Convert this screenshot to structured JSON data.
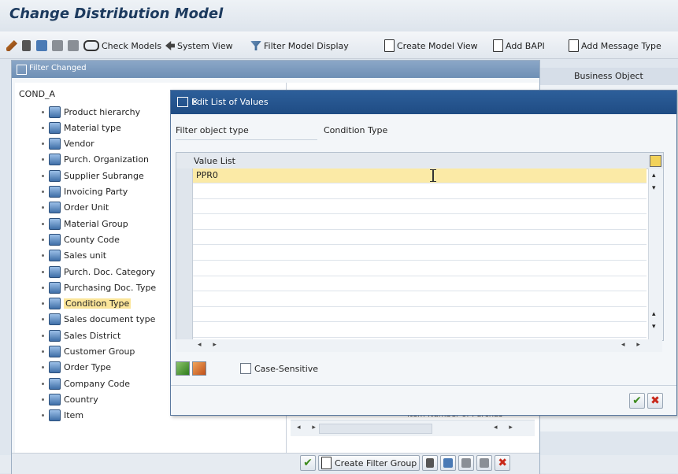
{
  "window": {
    "title": "Change Distribution Model"
  },
  "toolbar": {
    "check_models": "Check Models",
    "system_view": "System View",
    "filter_model_display": "Filter Model Display",
    "create_model_view": "Create Model View",
    "add_bapi": "Add BAPI",
    "add_message_type": "Add Message Type"
  },
  "background": {
    "business_object_header": "Business Object",
    "cut_text": "Item Number of Purchas"
  },
  "filter_dialog": {
    "title": "Filter Changed",
    "root": "COND_A",
    "items": [
      "Product hierarchy",
      "Material type",
      "Vendor",
      "Purch. Organization",
      "Supplier Subrange",
      "Invoicing Party",
      "Order Unit",
      "Material Group",
      "County Code",
      "Sales unit",
      "Purch. Doc. Category",
      "Purchasing Doc. Type",
      "Condition Type",
      "Sales document type",
      "Sales District",
      "Customer Group",
      "Order Type",
      "Company Code",
      "Country",
      "Item"
    ],
    "selected_item": "Condition Type",
    "create_filter_group": "Create Filter Group"
  },
  "edit_dialog": {
    "title": "Edit List of Values",
    "field_label": "Filter object type",
    "field_value": "Condition Type",
    "column_header": "Value List",
    "rows": [
      "PPR0",
      "",
      "",
      "",
      "",
      "",
      "",
      "",
      "",
      "",
      ""
    ],
    "case_sensitive": "Case-Sensitive"
  }
}
